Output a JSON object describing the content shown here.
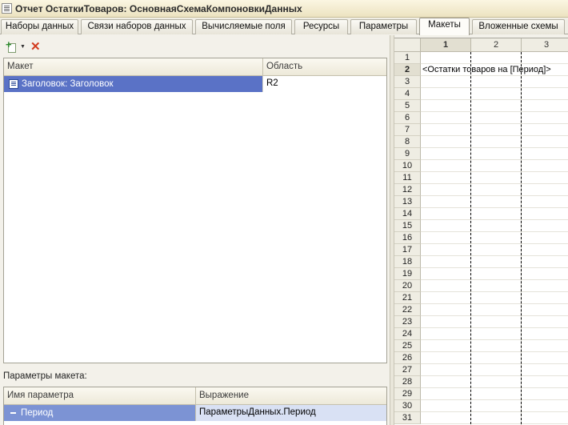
{
  "window": {
    "title": "Отчет ОстаткиТоваров: ОсновнаяСхемаКомпоновкиДанных"
  },
  "tabs": [
    {
      "label": "Наборы данных",
      "active": false
    },
    {
      "label": "Связи наборов данных",
      "active": false
    },
    {
      "label": "Вычисляемые поля",
      "active": false
    },
    {
      "label": "Ресурсы",
      "active": false
    },
    {
      "label": "Параметры",
      "active": false
    },
    {
      "label": "Макеты",
      "active": true
    },
    {
      "label": "Вложенные схемы",
      "active": false
    }
  ],
  "toolbar": {
    "add_icon": "add-doc-icon",
    "delete_icon": "delete-x-icon"
  },
  "layouts_table": {
    "columns": [
      "Макет",
      "Область"
    ],
    "rows": [
      {
        "layout": "Заголовок: Заголовок",
        "area": "R2"
      }
    ]
  },
  "layout_params": {
    "label": "Параметры макета:",
    "columns": [
      "Имя параметра",
      "Выражение"
    ],
    "rows": [
      {
        "name": "Период",
        "expression": "ПараметрыДанных.Период"
      }
    ]
  },
  "sheet": {
    "columns": [
      "1",
      "2",
      "3"
    ],
    "rows": [
      "1",
      "2",
      "3",
      "4",
      "5",
      "6",
      "7",
      "8",
      "9",
      "10",
      "11",
      "12",
      "13",
      "14",
      "15",
      "16",
      "17",
      "18",
      "19",
      "20",
      "21",
      "22",
      "23",
      "24",
      "25",
      "26",
      "27",
      "28",
      "29",
      "30",
      "31"
    ],
    "active_row": "2",
    "active_column": "1",
    "cell_text": "<Остатки товаров на [Период]>"
  },
  "colors": {
    "selection": "#5a72c6",
    "title_bg": "#f4eed6"
  }
}
